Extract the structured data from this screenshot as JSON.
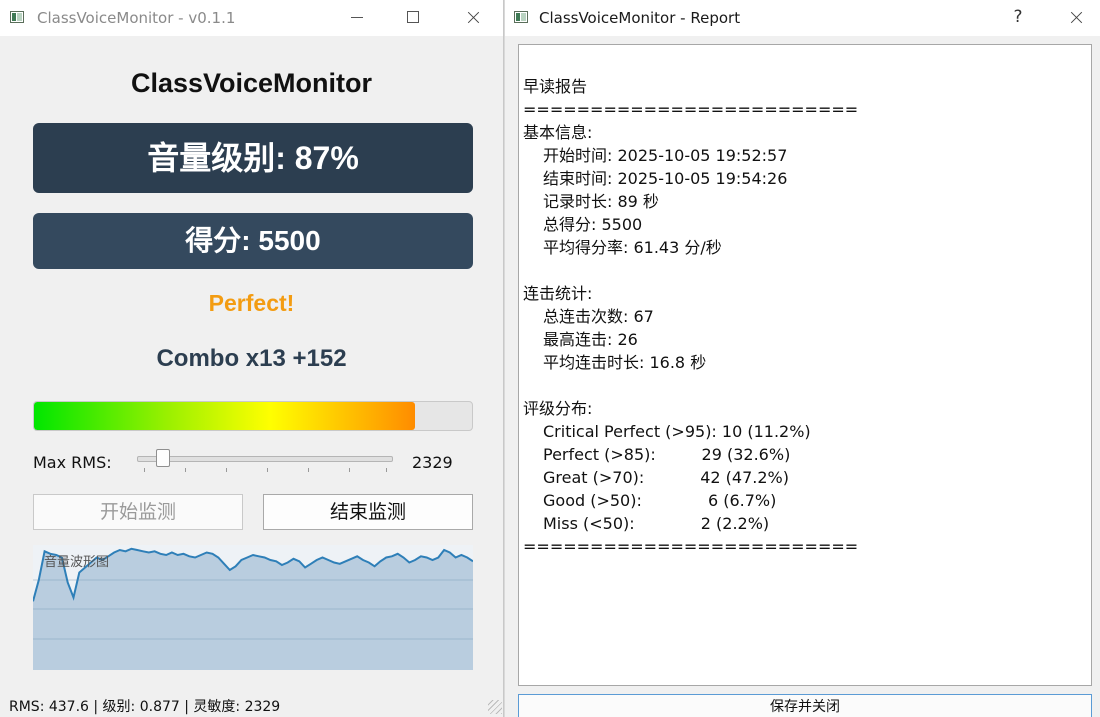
{
  "main_window": {
    "title": "ClassVoiceMonitor - v0.1.1",
    "heading": "ClassVoiceMonitor",
    "volume_level_text": "音量级别: 87%",
    "score_text": "得分: 5500",
    "rating_text": "Perfect!",
    "combo_text": "Combo x13 +152",
    "level_percent": 87,
    "max_rms_label": "Max RMS:",
    "max_rms_value": "2329",
    "slider_fraction": 0.08,
    "start_button_label": "开始监测",
    "stop_button_label": "结束监测",
    "waveform_title": "音量波形图",
    "status_text": "RMS: 437.6 | 级别: 0.877 | 灵敏度: 2329",
    "colors": {
      "volume_panel": "#2c3e50",
      "score_panel": "#34495e",
      "rating": "#f39c12",
      "combo": "#2c3e50",
      "wave_line": "#2e7fb8"
    }
  },
  "report_window": {
    "title": "ClassVoiceMonitor - Report",
    "help_label": "?",
    "save_close_label": "保存并关闭",
    "lines": [
      {
        "text": "早读报告",
        "indent": false
      },
      {
        "text": "=========================",
        "indent": false
      },
      {
        "text": "基本信息:",
        "indent": false
      },
      {
        "text": "开始时间: 2025-10-05 19:52:57",
        "indent": true
      },
      {
        "text": "结束时间: 2025-10-05 19:54:26",
        "indent": true
      },
      {
        "text": "记录时长: 89 秒",
        "indent": true
      },
      {
        "text": "总得分: 5500",
        "indent": true
      },
      {
        "text": "平均得分率: 61.43 分/秒",
        "indent": true
      },
      {
        "text": "",
        "indent": false
      },
      {
        "text": "连击统计:",
        "indent": false
      },
      {
        "text": "总连击次数: 67",
        "indent": true
      },
      {
        "text": "最高连击: 26",
        "indent": true
      },
      {
        "text": "平均连击时长: 16.8 秒",
        "indent": true
      },
      {
        "text": "",
        "indent": false
      },
      {
        "text": "评级分布:",
        "indent": false
      },
      {
        "text": "Critical Perfect (>95): 10 (11.2%)",
        "indent": true
      },
      {
        "text": "Perfect (>85):         29 (32.6%)",
        "indent": true
      },
      {
        "text": "Great (>70):           42 (47.2%)",
        "indent": true
      },
      {
        "text": "Good (>50):             6 (6.7%)",
        "indent": true
      },
      {
        "text": "Miss (<50):             2 (2.2%)",
        "indent": true
      },
      {
        "text": "=========================",
        "indent": false
      }
    ]
  },
  "chart_data": {
    "type": "area",
    "title": "音量波形图",
    "values": [
      0.55,
      0.72,
      0.95,
      0.93,
      0.92,
      0.9,
      0.7,
      0.58,
      0.78,
      0.82,
      0.86,
      0.9,
      0.88,
      0.91,
      0.94,
      0.96,
      0.95,
      0.97,
      0.96,
      0.95,
      0.94,
      0.95,
      0.93,
      0.92,
      0.94,
      0.92,
      0.93,
      0.91,
      0.9,
      0.92,
      0.94,
      0.93,
      0.9,
      0.85,
      0.8,
      0.83,
      0.88,
      0.9,
      0.92,
      0.91,
      0.9,
      0.88,
      0.87,
      0.84,
      0.86,
      0.89,
      0.87,
      0.82,
      0.85,
      0.88,
      0.9,
      0.88,
      0.86,
      0.85,
      0.87,
      0.89,
      0.91,
      0.88,
      0.86,
      0.83,
      0.87,
      0.9,
      0.91,
      0.93,
      0.9,
      0.86,
      0.88,
      0.91,
      0.9,
      0.88,
      0.9,
      0.96,
      0.94,
      0.9,
      0.92,
      0.9,
      0.87
    ],
    "ylim": [
      0,
      1
    ]
  }
}
